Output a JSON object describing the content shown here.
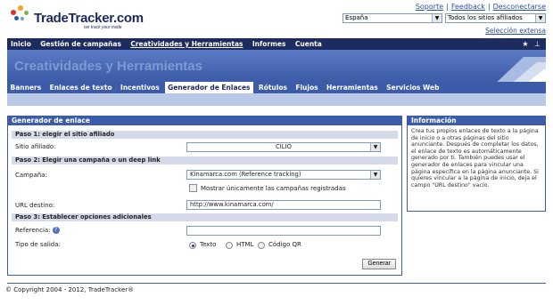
{
  "header": {
    "logo_text": "TradeTracker.com",
    "logo_tagline": "we track your trade",
    "links": [
      "Soporte",
      "Feedback",
      "Desconectarse"
    ],
    "country_select": "España",
    "sites_select": "Todos los sitios afiliados",
    "extended_selection_link": "Selección extensa"
  },
  "main_nav": {
    "items": [
      "Inicio",
      "Gestión de campañas",
      "Creatividades y Herramientas",
      "Informes",
      "Cuenta"
    ],
    "active_index": 2
  },
  "banner": {
    "title": "Creatividades y Herramientas"
  },
  "sub_nav": {
    "items": [
      "Banners",
      "Enlaces de texto",
      "Incentivos",
      "Generador de Enlaces",
      "Rótulos",
      "Flujos",
      "Herramientas",
      "Servicios Web"
    ],
    "active_index": 3
  },
  "generator": {
    "title": "Generador de enlace",
    "step1_title": "Paso 1: elegir el sitio afiliado",
    "site_label": "Sitio afiliado:",
    "site_value": "CILIO",
    "step2_title": "Paso 2: Elegir una campaña o un deep link",
    "campaign_label": "Campaña:",
    "campaign_value": "Kinamarca.com (Reference tracking)",
    "registered_only_label": "Mostrar únicamente las campañas registradas",
    "url_label": "URL destino:",
    "url_value": "http://www.kinamarca.com/",
    "step3_title": "Paso 3: Establecer opciones adicionales",
    "reference_label": "Referencia:",
    "reference_value": "",
    "output_label": "Tipo de salida:",
    "output_options": [
      "Texto",
      "HTML",
      "Código QR"
    ],
    "output_selected_index": 0,
    "generate_button": "Generar"
  },
  "info": {
    "title": "Información",
    "text": "Crea tus propios enlaces de texto a la página de inicio o a otras páginas del sitio anunciante. Después de completar los datos, el enlace de texto es automáticamente generado por ti. También puedes usar el generador de enlaces para vincular una página específica en la página anunciante. Si quieres vincular a la página de inicio, deja el campo \"URL destino\" vacío."
  },
  "footer": {
    "copyright": "© Copyright 2004 - 2012, TradeTracker®"
  },
  "colors": {
    "nav_dark": "#1d2b5e",
    "nav_blue": "#3c5ba8",
    "link": "#2a4ea0"
  }
}
